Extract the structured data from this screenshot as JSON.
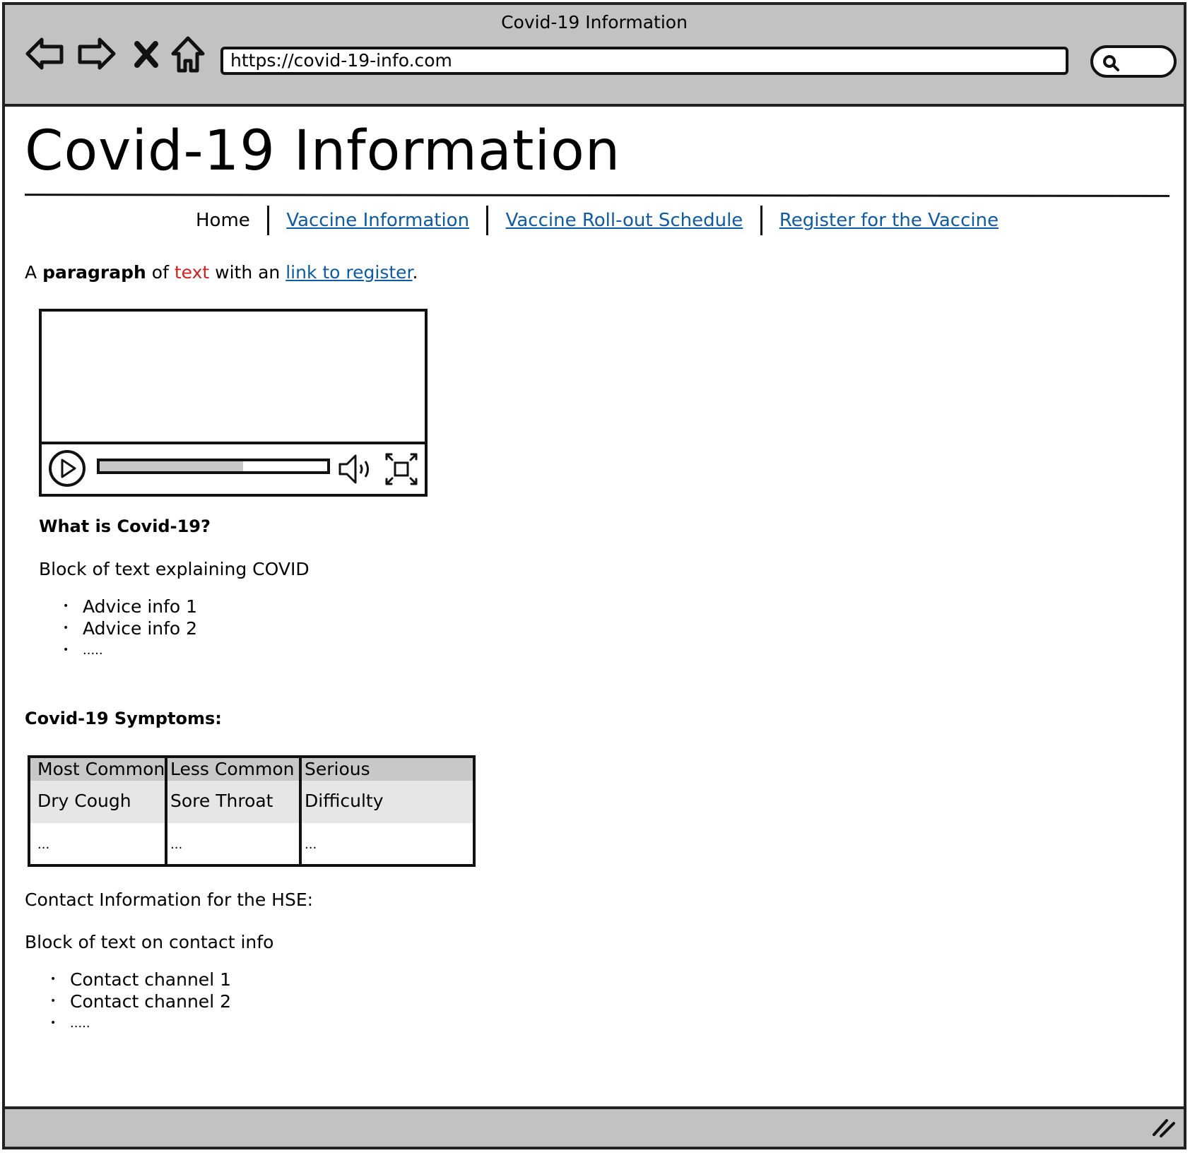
{
  "window": {
    "title": "Covid-19 Information"
  },
  "toolbar": {
    "back_icon": "back-arrow-icon",
    "forward_icon": "forward-arrow-icon",
    "stop_icon": "close-icon",
    "home_icon": "home-icon",
    "url": "https://covid-19-info.com",
    "search_icon": "search-icon"
  },
  "page": {
    "title": "Covid-19 Information",
    "nav": {
      "home": "Home",
      "links": [
        "Vaccine Information",
        "Vaccine Roll-out Schedule",
        "Register for the Vaccine"
      ]
    },
    "intro": {
      "a": "A ",
      "bold": "paragraph",
      "of": " of ",
      "red": "text",
      "with": " with an ",
      "link": "link to register",
      "end": "."
    },
    "video": {
      "progress_fraction": 0.63,
      "play_icon": "play-icon",
      "volume_icon": "volume-icon",
      "fullscreen_icon": "fullscreen-icon"
    },
    "what_heading": "What is Covid-19?",
    "what_block": "Block of text explaining COVID",
    "advice": [
      "Advice info 1",
      "Advice info 2",
      "....."
    ],
    "symptoms_heading": "Covid-19 Symptoms:",
    "symptoms_table": {
      "headers": [
        "Most Common",
        "Less Common",
        "Serious"
      ],
      "rows": [
        [
          "Dry Cough",
          "Sore Throat",
          "Difficulty breathing"
        ],
        [
          "...",
          "...",
          "..."
        ]
      ]
    },
    "contact_heading": "Contact Information for the HSE:",
    "contact_block": "Block of text on contact info",
    "contacts": [
      "Contact channel 1",
      "Contact channel 2",
      "....."
    ]
  },
  "colors": {
    "chrome": "#c2c2c2",
    "link": "#0f5aa0",
    "red_text": "#cc2222",
    "table_header": "#c8c8c8",
    "table_row_alt": "#e6e6e6"
  }
}
